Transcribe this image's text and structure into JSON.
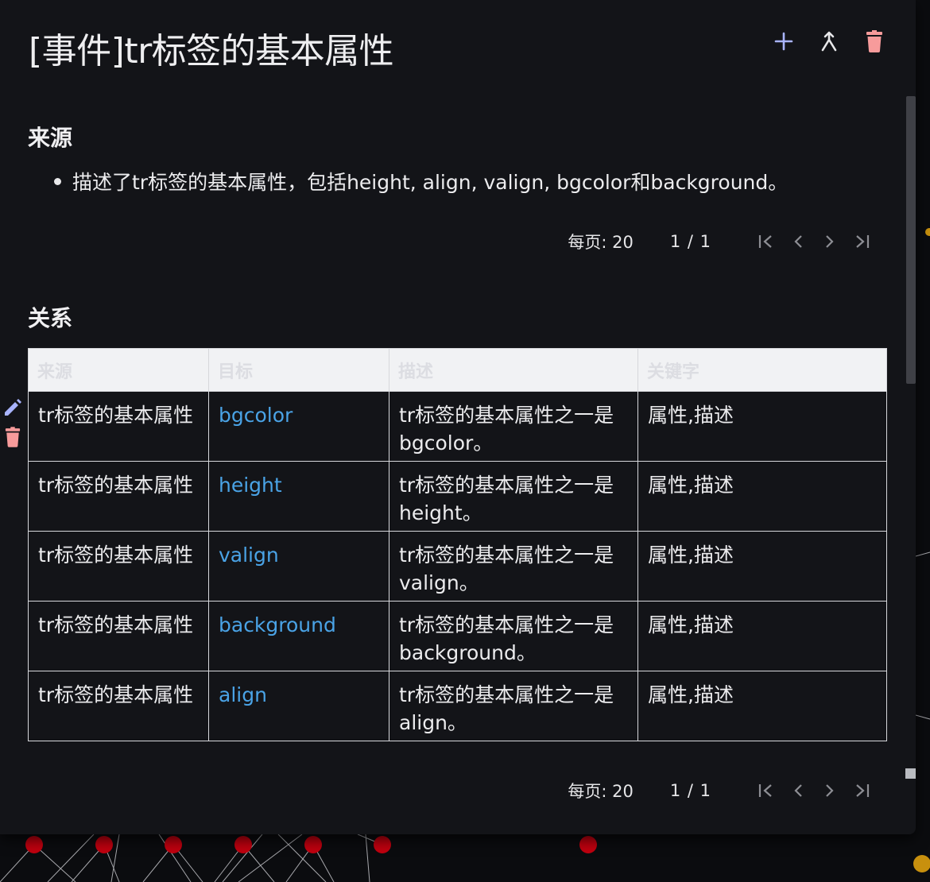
{
  "page": {
    "title": "[事件]tr标签的基本属性"
  },
  "toolbar": {
    "actions": [
      {
        "name": "add-icon",
        "color": "#a9b4ff"
      },
      {
        "name": "merge-icon",
        "color": "#e8e8ea"
      },
      {
        "name": "delete-icon",
        "color": "#f79b9b"
      }
    ]
  },
  "source_section": {
    "heading": "来源",
    "items": [
      "描述了tr标签的基本属性，包括height, align, valign, bgcolor和background。"
    ],
    "pager": {
      "per_page": "每页: 20",
      "pages": "1 / 1"
    }
  },
  "relations_section": {
    "heading": "关系",
    "columns": [
      "来源",
      "目标",
      "描述",
      "关键字"
    ],
    "rows": [
      {
        "source": "tr标签的基本属性",
        "target": "bgcolor",
        "description": "tr标签的基本属性之一是bgcolor。",
        "keywords": "属性,描述"
      },
      {
        "source": "tr标签的基本属性",
        "target": "height",
        "description": "tr标签的基本属性之一是height。",
        "keywords": "属性,描述"
      },
      {
        "source": "tr标签的基本属性",
        "target": "valign",
        "description": "tr标签的基本属性之一是valign。",
        "keywords": "属性,描述"
      },
      {
        "source": "tr标签的基本属性",
        "target": "background",
        "description": "tr标签的基本属性之一是background。",
        "keywords": "属性,描述"
      },
      {
        "source": "tr标签的基本属性",
        "target": "align",
        "description": "tr标签的基本属性之一是align。",
        "keywords": "属性,描述"
      }
    ],
    "pager": {
      "per_page": "每页: 20",
      "pages": "1 / 1"
    }
  },
  "row_actions": [
    "edit-icon",
    "delete-icon"
  ],
  "colors": {
    "panel_bg": "#131418",
    "link": "#4aa3e6",
    "graph_node": "#c0000f",
    "graph_node_alt": "#c8900e"
  }
}
